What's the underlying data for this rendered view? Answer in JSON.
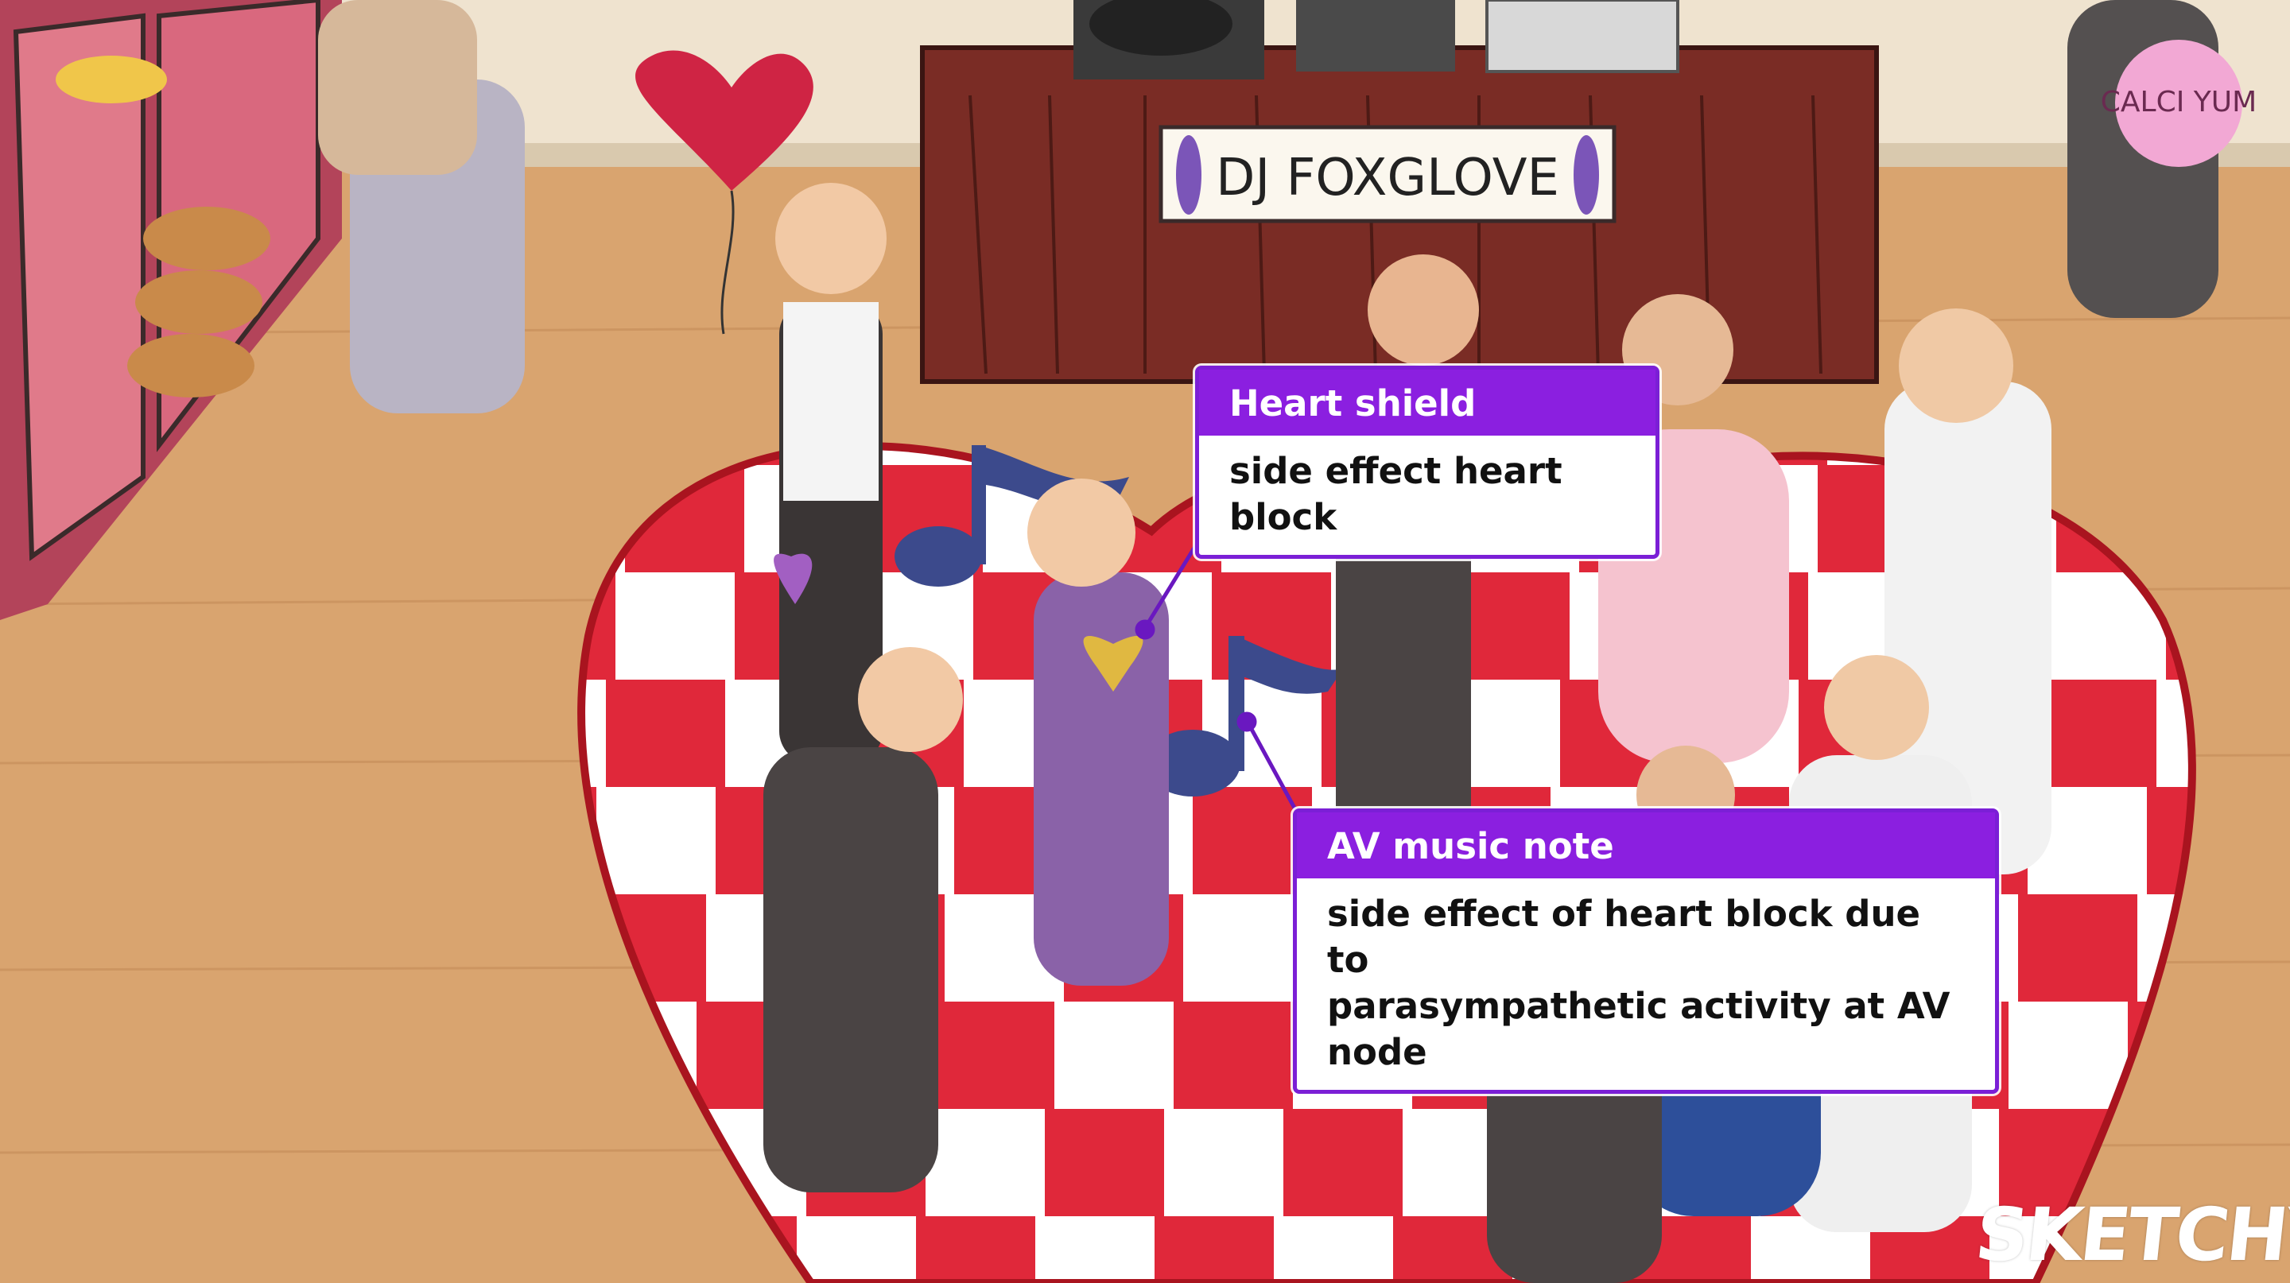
{
  "scene": {
    "sign_text": "DJ FOXGLOVE",
    "tub_text": "CALCI YUM"
  },
  "callouts": [
    {
      "title": "Heart shield",
      "body": [
        "side effect heart block"
      ]
    },
    {
      "title": "AV music note",
      "body": [
        "side effect of heart block due to",
        "parasympathetic activity at AV node"
      ]
    }
  ],
  "brand": "SKETCHY",
  "colors": {
    "callout_header": "#8b1fe0",
    "callout_border": "#7b1fd6",
    "floor_red": "#e0283a",
    "music_note": "#3c4a8c"
  }
}
